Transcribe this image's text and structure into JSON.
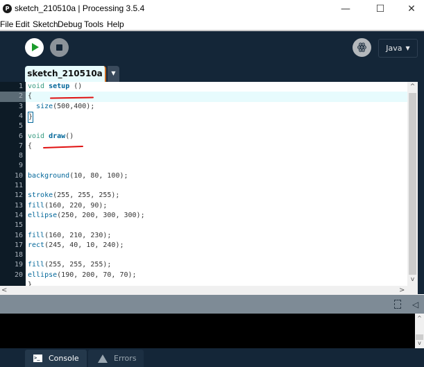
{
  "window": {
    "title": "sketch_210510a | Processing 3.5.4",
    "logo": "P",
    "controls": {
      "minimize": "—",
      "maximize": "☐",
      "close": "✕"
    }
  },
  "menu": [
    "File",
    "Edit",
    "Sketch",
    "Debug",
    "Tools",
    "Help"
  ],
  "toolbar": {
    "run_icon": "play-icon",
    "stop_icon": "stop-icon",
    "debug_icon": "butterfly-icon",
    "debug_glyph": "ꙮ",
    "mode_label": "Java",
    "mode_caret": "▼"
  },
  "tabs": {
    "active": "sketch_210510a",
    "menu_caret": "▼"
  },
  "editor": {
    "current_line": 2,
    "line_numbers": [
      "1",
      "2",
      "3",
      "4",
      "5",
      "6",
      "7",
      "8",
      "9",
      "10",
      "11",
      "12",
      "13",
      "14",
      "15",
      "16",
      "17",
      "18",
      "19",
      "20"
    ],
    "lines": [
      {
        "type": "void",
        "fn": "setup",
        "rest": " ()"
      },
      {
        "plain": "{"
      },
      {
        "indent": "  ",
        "call": "size",
        "args": "(500,400);"
      },
      {
        "bracket": "}"
      },
      {
        "plain": ""
      },
      {
        "type": "void",
        "fn": "draw",
        "rest": "()"
      },
      {
        "plain": "{"
      },
      {
        "plain": ""
      },
      {
        "plain": ""
      },
      {
        "call": "background",
        "args": "(10, 80, 100);"
      },
      {
        "plain": ""
      },
      {
        "call": "stroke",
        "args": "(255, 255, 255);"
      },
      {
        "call": "fill",
        "args": "(160, 220, 90);"
      },
      {
        "call": "ellipse",
        "args": "(250, 200, 300, 300);"
      },
      {
        "plain": ""
      },
      {
        "call": "fill",
        "args": "(160, 210, 230);"
      },
      {
        "call": "rect",
        "args": "(245, 40, 10, 240);"
      },
      {
        "plain": ""
      },
      {
        "call": "fill",
        "args": "(255, 255, 255);"
      },
      {
        "call": "ellipse",
        "args": "(190, 200, 70, 70);"
      }
    ],
    "partial_line": "}",
    "scroll_up": "^",
    "scroll_down": "v",
    "scroll_left": "<",
    "scroll_right": ">"
  },
  "console": {
    "copy_icon": "copy-icon",
    "collapse_glyph": "◁",
    "scroll_up": "^",
    "scroll_down": "v"
  },
  "footer": {
    "console_label": "Console",
    "console_glyph": ">_",
    "errors_label": "Errors"
  },
  "colors": {
    "toolbar_bg": "#142638",
    "run_green": "#1a9c2b",
    "keyword_type": "#33997e",
    "keyword_fn": "#006699",
    "current_line_bg": "#e7fbfd",
    "annotation_red": "#e01010"
  }
}
